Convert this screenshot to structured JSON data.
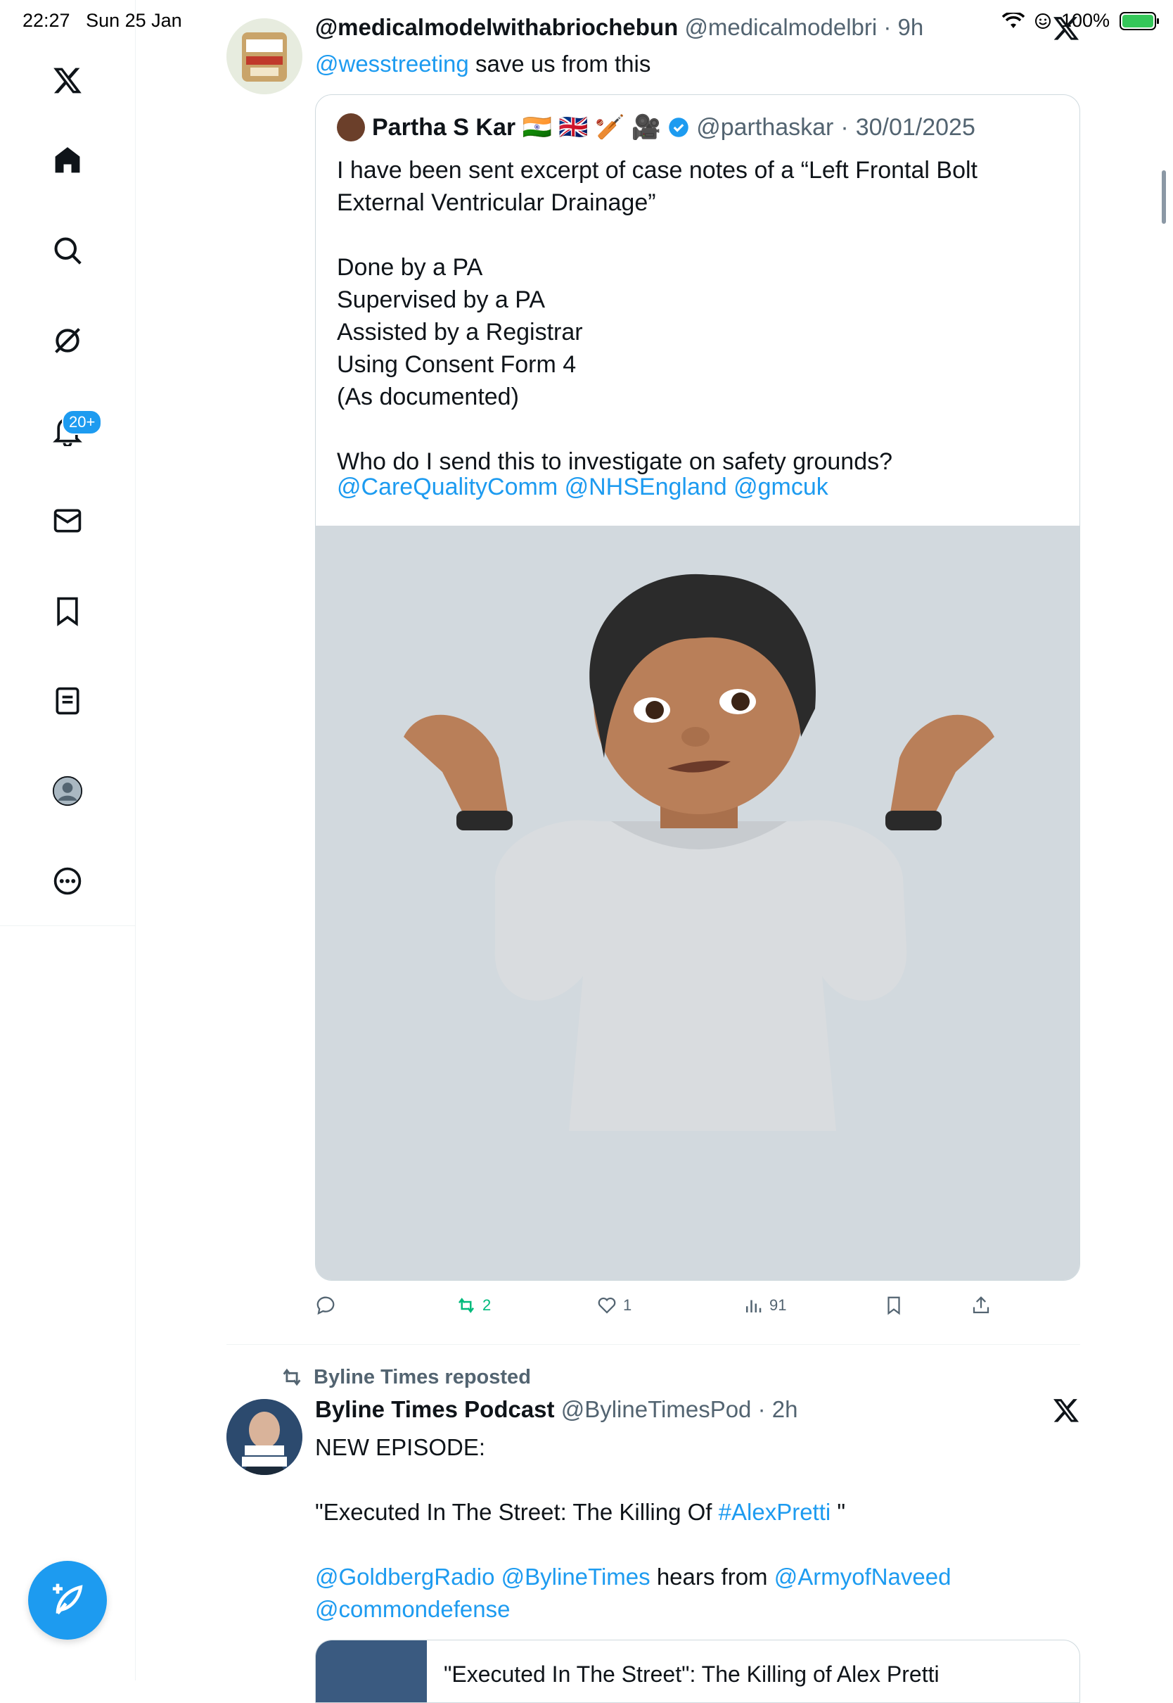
{
  "status_bar": {
    "time": "22:27",
    "date": "Sun 25 Jan",
    "battery": "100%",
    "battery_level": 1.0
  },
  "sidebar": {
    "items": [
      {
        "icon": "x-logo-icon"
      },
      {
        "icon": "home-icon"
      },
      {
        "icon": "search-icon"
      },
      {
        "icon": "grok-icon"
      },
      {
        "icon": "notifications-icon",
        "badge": "20+"
      },
      {
        "icon": "messages-icon"
      },
      {
        "icon": "bookmarks-icon"
      },
      {
        "icon": "lists-icon"
      },
      {
        "icon": "profile-icon"
      },
      {
        "icon": "more-icon"
      }
    ],
    "compose_icon": "compose-icon"
  },
  "tweet1": {
    "display_name": "@medicalmodelwithabriochebun",
    "handle": "@medicalmodelbri",
    "time": "9h",
    "mention": "@wesstreeting",
    "text": "save us from this",
    "quote": {
      "display_name": "Partha S Kar 🇮🇳 🇬🇧 🏏 🎥",
      "handle": "@parthaskar",
      "date": "30/01/2025",
      "text": "I have been sent excerpt of case notes of a “Left Frontal Bolt External Ventricular Drainage”\n\nDone by a PA\nSupervised by a PA\nAssisted by a Registrar\nUsing Consent Form 4\n(As documented)\n\nWho do I send this to investigate on safety grounds?",
      "links": [
        "@CareQualityComm",
        "@NHSEngland",
        "@gmcuk"
      ]
    },
    "actions": {
      "reposts": "2",
      "likes": "1",
      "views": "91"
    }
  },
  "tweet2": {
    "repost_label": "Byline Times reposted",
    "display_name": "Byline Times Podcast",
    "handle": "@BylineTimesPod",
    "time": "2h",
    "line1": "NEW EPISODE:",
    "line2_pre": "\"Executed In The Street:  The Killing Of ",
    "hashtag": "#AlexPretti",
    "line2_post": " \"",
    "mentions1": [
      "@GoldbergRadio",
      "@BylineTimes"
    ],
    "hears_from": "hears from",
    "mention2": "@ArmyofNaveed",
    "mention3": "@commondefense",
    "card_title": "\"Executed In The Street\": The Killing of Alex Pretti"
  },
  "colors": {
    "accent": "#1d9bf0",
    "repost_green": "#00ba7c",
    "text": "#0f1419",
    "muted": "#536471"
  }
}
